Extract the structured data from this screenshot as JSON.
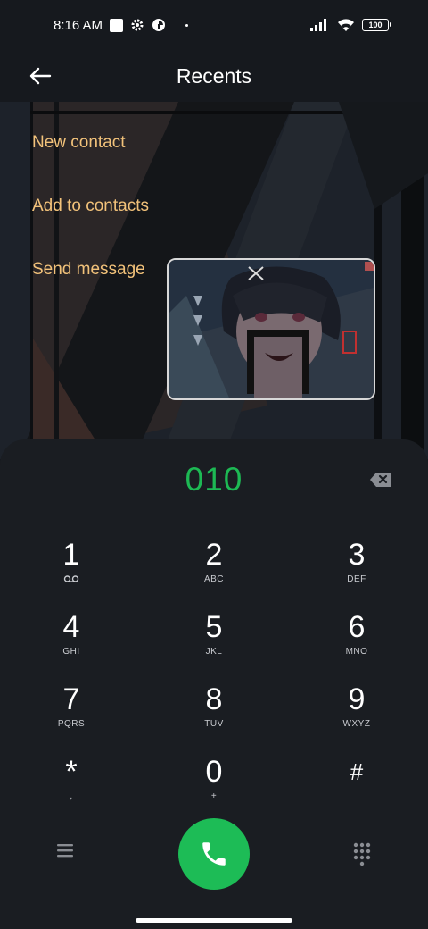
{
  "status_bar": {
    "time": "8:16 AM",
    "battery": "100"
  },
  "header": {
    "title": "Recents"
  },
  "actions": {
    "new_contact": "New contact",
    "add_to_contacts": "Add to contacts",
    "send_message": "Send message"
  },
  "dial": {
    "number": "010"
  },
  "keys": [
    {
      "digit": "1",
      "letters": ""
    },
    {
      "digit": "2",
      "letters": "ABC"
    },
    {
      "digit": "3",
      "letters": "DEF"
    },
    {
      "digit": "4",
      "letters": "GHI"
    },
    {
      "digit": "5",
      "letters": "JKL"
    },
    {
      "digit": "6",
      "letters": "MNO"
    },
    {
      "digit": "7",
      "letters": "PQRS"
    },
    {
      "digit": "8",
      "letters": "TUV"
    },
    {
      "digit": "9",
      "letters": "WXYZ"
    },
    {
      "digit": "*",
      "letters": ","
    },
    {
      "digit": "0",
      "letters": "+"
    },
    {
      "digit": "#",
      "letters": ""
    }
  ],
  "colors": {
    "accent_green": "#1db954",
    "action_text": "#f2c27a",
    "panel_bg": "#1a1d22"
  },
  "icons": [
    "settings-icon",
    "data-saver-icon",
    "signal-icon",
    "wifi-icon",
    "back-arrow-icon",
    "backspace-icon",
    "voicemail-icon",
    "menu-icon",
    "phone-icon",
    "dialpad-icon"
  ]
}
